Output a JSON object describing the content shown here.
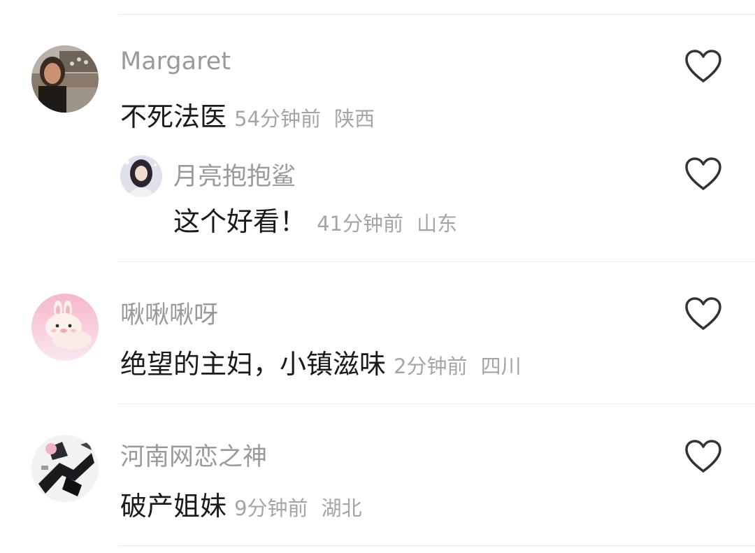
{
  "comments": [
    {
      "username": "Margaret",
      "text": "不死法医",
      "time": "54分钟前",
      "location": "陕西",
      "liked": false,
      "replies": [
        {
          "username": "月亮抱抱鲨",
          "text": "这个好看！",
          "time": "41分钟前",
          "location": "山东",
          "liked": false
        }
      ]
    },
    {
      "username": "啾啾啾呀",
      "text": "绝望的主妇，小镇滋味",
      "time": "2分钟前",
      "location": "四川",
      "liked": false
    },
    {
      "username": "河南网恋之神",
      "text": "破产姐妹",
      "time": "9分钟前",
      "location": "湖北",
      "liked": false
    }
  ],
  "icons": {
    "like": "heart-outline-icon"
  },
  "colors": {
    "username": "#9a9a9a",
    "comment_text": "#1a1a1a",
    "meta": "#a5a5a5",
    "heart_stroke": "#333333",
    "divider": "#ececec"
  }
}
